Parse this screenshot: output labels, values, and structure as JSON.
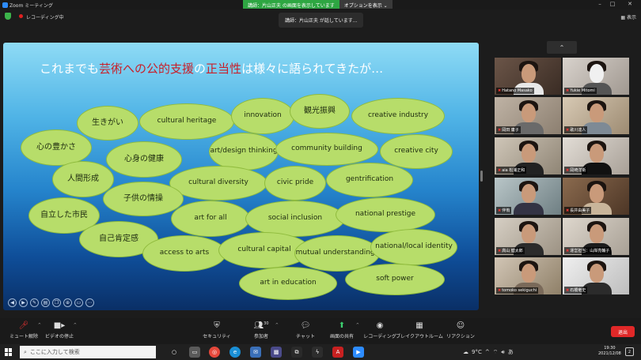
{
  "window": {
    "title": "Zoom ミーティング",
    "share_banner": "講師：片山正夫 の画面を表示しています",
    "options_label": "オプションを表示",
    "recording_label": "レコーディング中",
    "speaker_notice": "講師：片山正夫 が話しています...",
    "view_label": "表示",
    "controls": {
      "minimize": "–",
      "maximize": "□",
      "close": "✕"
    }
  },
  "slide": {
    "title_parts": [
      "これまでも",
      "芸術への公的支援",
      "の",
      "正当性",
      "は様々に語られてきたが…"
    ],
    "highlight_color": "#c8202a",
    "bubbles": [
      "生きがい",
      "cultural heritage",
      "innovation",
      "観光振興",
      "creative industry",
      "心の豊かさ",
      "心身の健康",
      "art/design thinking",
      "community building",
      "creative city",
      "人間形成",
      "cultural diversity",
      "civic pride",
      "gentrification",
      "子供の情操",
      "自立した市民",
      "art for all",
      "social inclusion",
      "national prestige",
      "自己肯定感",
      "access to arts",
      "cultural capital",
      "mutual understandings",
      "national/local identity",
      "art in education",
      "soft power"
    ]
  },
  "participants": [
    {
      "name": "Hatano Masako"
    },
    {
      "name": "Yukie Mitomi"
    },
    {
      "name": "岡田 庸子"
    },
    {
      "name": "歌川達人"
    },
    {
      "name": "aia 松浦正和"
    },
    {
      "name": "岡崎洋衛"
    },
    {
      "name": "伴侑"
    },
    {
      "name": "長井由美子"
    },
    {
      "name": "高山 健太郎"
    },
    {
      "name": "運営担当：山岸亮輔子"
    },
    {
      "name": "tomoko sekiguchi"
    },
    {
      "name": "石橋竜史"
    }
  ],
  "toolbar": {
    "mute": "ミュート解除",
    "video": "ビデオの停止",
    "security": "セキュリティ",
    "participants": "参加者",
    "participant_count": "30",
    "chat": "チャット",
    "share": "画面の共有",
    "record": "レコーディング",
    "breakout": "ブレイクアウトルーム",
    "reactions": "リアクション",
    "end": "退出"
  },
  "taskbar": {
    "search_placeholder": "ここに入力して検索",
    "weather": "9°C",
    "ime": "あ",
    "time": "19:30",
    "date": "2021/12/08",
    "notifications": "2"
  }
}
